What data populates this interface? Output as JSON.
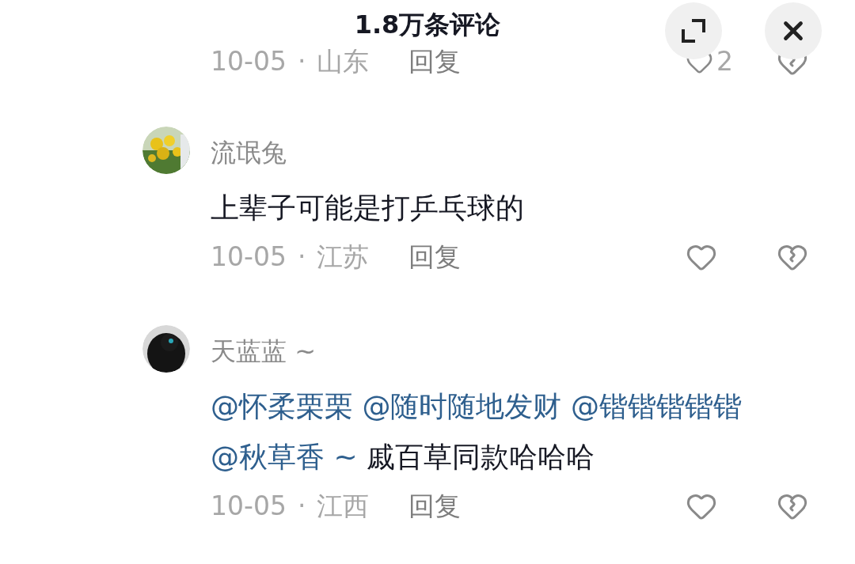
{
  "header": {
    "title": "1.8万条评论"
  },
  "partial_comment": {
    "date": "10-05",
    "separator": "·",
    "location": "山东",
    "reply": "回复",
    "likes": "2"
  },
  "comments": [
    {
      "avatar": {
        "kind": "picture"
      },
      "name": "流氓兔",
      "segments": [
        {
          "kind": "text",
          "text": "上辈子可能是打乒乓球的"
        }
      ],
      "date": "10-05",
      "separator": "·",
      "location": "江苏",
      "reply": "回复"
    },
    {
      "avatar": {
        "kind": "picture"
      },
      "name": "天蓝蓝 ~",
      "segments": [
        {
          "kind": "mention",
          "text": "@怀柔栗栗"
        },
        {
          "kind": "mention",
          "text": "@随时随地发财"
        },
        {
          "kind": "mention",
          "text": "@锴锴锴锴锴"
        },
        {
          "kind": "mention",
          "text": "@秋草香 ~"
        },
        {
          "kind": "text",
          "text": "戚百草同款哈哈哈"
        }
      ],
      "date": "10-05",
      "separator": "·",
      "location": "江西",
      "reply": "回复"
    }
  ]
}
